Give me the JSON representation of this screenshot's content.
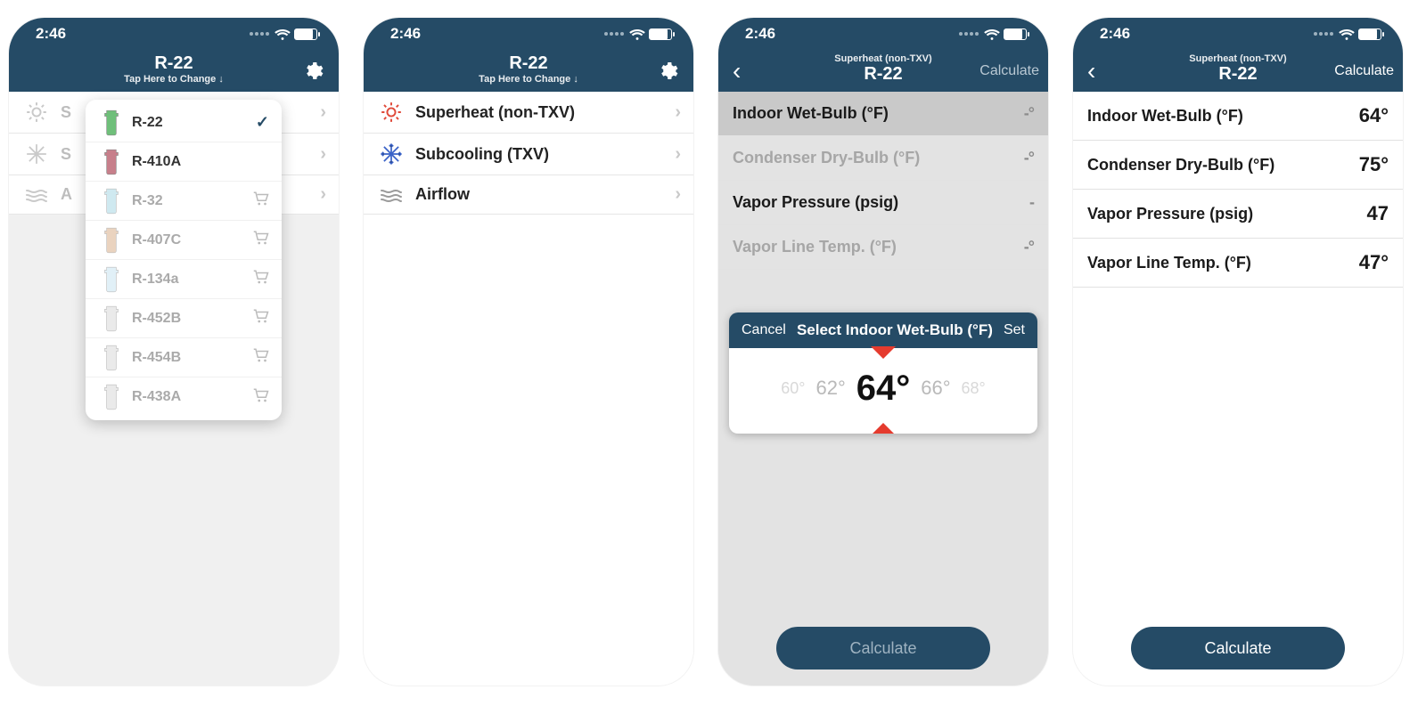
{
  "status": {
    "time": "2:46"
  },
  "header_main": {
    "title": "R-22",
    "sub": "Tap Here to Change ↓"
  },
  "header_detail": {
    "sup": "Superheat (non-TXV)",
    "title": "R-22",
    "right_btn": "Calculate"
  },
  "main_menu": {
    "superheat": "Superheat (non-TXV)",
    "subcooling": "Subcooling (TXV)",
    "airflow": "Airflow",
    "short_s": "S",
    "short_a": "A"
  },
  "refrigerants": [
    {
      "name": "R-22",
      "color": "#6fbf7a",
      "owned": true,
      "selected": true
    },
    {
      "name": "R-410A",
      "color": "#c77f8b",
      "owned": true,
      "selected": false
    },
    {
      "name": "R-32",
      "color": "#a9d8e4",
      "owned": false,
      "selected": false
    },
    {
      "name": "R-407C",
      "color": "#d9b08c",
      "owned": false,
      "selected": false
    },
    {
      "name": "R-134a",
      "color": "#c9e4f1",
      "owned": false,
      "selected": false
    },
    {
      "name": "R-452B",
      "color": "#d9d9d9",
      "owned": false,
      "selected": false
    },
    {
      "name": "R-454B",
      "color": "#d9d9d9",
      "owned": false,
      "selected": false
    },
    {
      "name": "R-438A",
      "color": "#d9d9d9",
      "owned": false,
      "selected": false
    }
  ],
  "inputs": {
    "iwb": {
      "label": "Indoor Wet-Bulb (°F)",
      "value": "64°",
      "empty": "-°"
    },
    "cdb": {
      "label": "Condenser Dry-Bulb (°F)",
      "value": "75°",
      "empty": "-°"
    },
    "vp": {
      "label": "Vapor Pressure (psig)",
      "value": "47",
      "empty": "-"
    },
    "vlt": {
      "label": "Vapor Line Temp. (°F)",
      "value": "47°",
      "empty": "-°"
    }
  },
  "picker": {
    "cancel": "Cancel",
    "title": "Select Indoor Wet-Bulb (°F)",
    "set": "Set",
    "options": [
      "60°",
      "62°",
      "64°",
      "66°",
      "68°"
    ],
    "selected": "64°"
  },
  "buttons": {
    "calculate": "Calculate"
  }
}
